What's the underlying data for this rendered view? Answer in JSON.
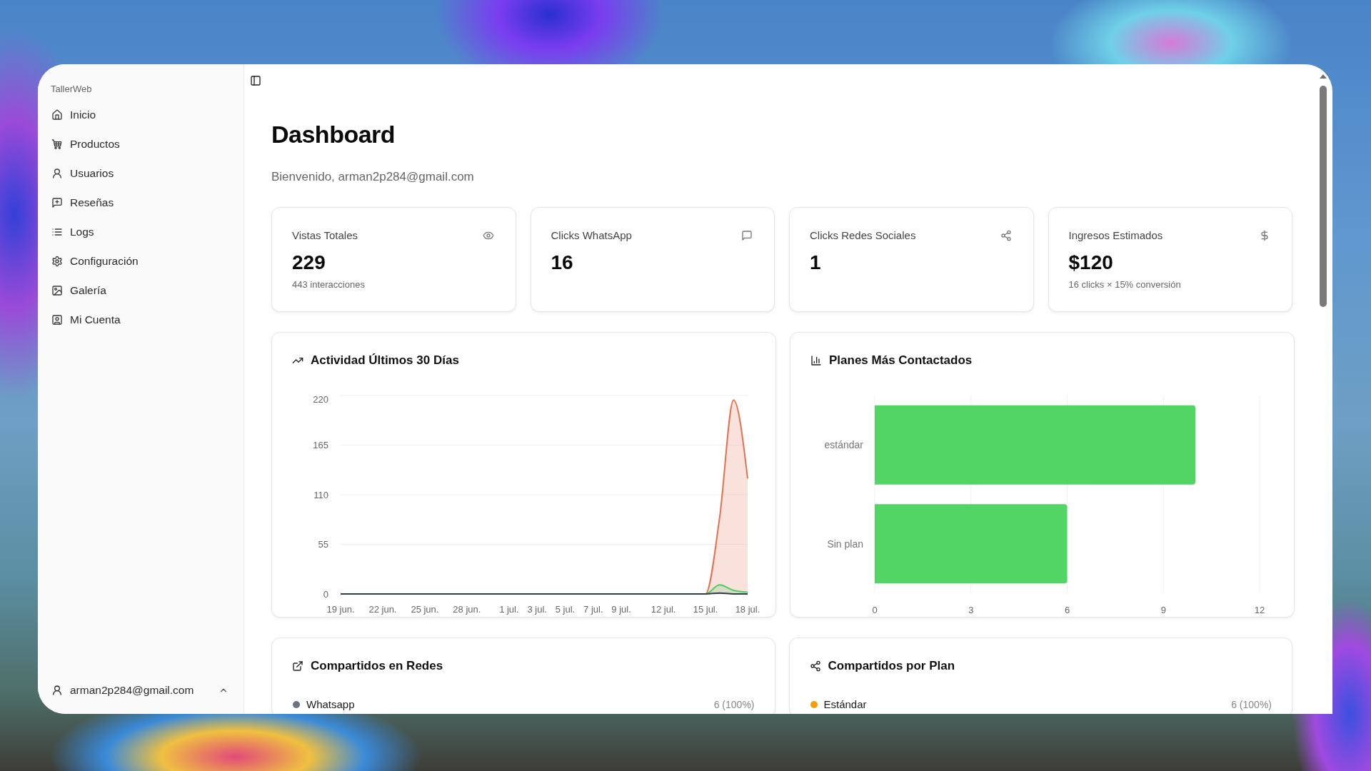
{
  "sidebar": {
    "brand": "TallerWeb",
    "items": [
      {
        "label": "Inicio"
      },
      {
        "label": "Productos"
      },
      {
        "label": "Usuarios"
      },
      {
        "label": "Reseñas"
      },
      {
        "label": "Logs"
      },
      {
        "label": "Configuración"
      },
      {
        "label": "Galería"
      },
      {
        "label": "Mi Cuenta"
      }
    ],
    "account": {
      "email": "arman2p284@gmail.com"
    }
  },
  "header": {
    "title": "Dashboard",
    "subtitle": "Bienvenido, arman2p284@gmail.com"
  },
  "stats": [
    {
      "label": "Vistas Totales",
      "value": "229",
      "detail": "443 interacciones"
    },
    {
      "label": "Clicks WhatsApp",
      "value": "16"
    },
    {
      "label": "Clicks Redes Sociales",
      "value": "1"
    },
    {
      "label": "Ingresos Estimados",
      "value": "$120",
      "detail": "16 clicks × 15% conversión"
    }
  ],
  "activity_chart": {
    "title": "Actividad Últimos 30 Días",
    "chart_data": {
      "type": "area",
      "stacked": false,
      "grid": true,
      "categories": [
        "19 jun.",
        null,
        null,
        "22 jun.",
        null,
        null,
        "25 jun.",
        null,
        null,
        "28 jun.",
        null,
        null,
        "1 jul.",
        null,
        "3 jul.",
        null,
        "5 jul.",
        null,
        "7 jul.",
        null,
        "9 jul.",
        null,
        null,
        "12 jul.",
        null,
        null,
        "15 jul.",
        null,
        null,
        "18 jul."
      ],
      "ylim": [
        0,
        220
      ],
      "yticks": [
        0,
        55,
        110,
        165,
        220
      ],
      "series": [
        {
          "color": "#e5704f",
          "values": [
            0,
            0,
            0,
            0,
            0,
            0,
            0,
            0,
            0,
            0,
            0,
            0,
            0,
            0,
            0,
            0,
            0,
            0,
            0,
            0,
            0,
            0,
            0,
            0,
            0,
            0,
            0,
            84,
            215,
            128
          ]
        },
        {
          "color": "#4ccf63",
          "values": [
            0,
            0,
            0,
            0,
            0,
            0,
            0,
            0,
            0,
            0,
            0,
            0,
            0,
            0,
            0,
            0,
            0,
            0,
            0,
            0,
            0,
            0,
            0,
            0,
            0,
            0,
            0,
            10,
            4,
            2
          ]
        },
        {
          "color": "#2f3e4e",
          "values": [
            0,
            0,
            0,
            0,
            0,
            0,
            0,
            0,
            0,
            0,
            0,
            0,
            0,
            0,
            0,
            0,
            0,
            0,
            0,
            0,
            0,
            0,
            0,
            0,
            0,
            0,
            0,
            1,
            0,
            0
          ]
        }
      ]
    }
  },
  "plans_chart": {
    "title": "Planes Más Contactados",
    "chart_data": {
      "type": "bar",
      "orientation": "horizontal",
      "grid": true,
      "categories": [
        "estándar",
        "Sin plan"
      ],
      "series": [
        {
          "color": "#53d566",
          "values": [
            10,
            6
          ]
        }
      ],
      "xlim": [
        0,
        12
      ],
      "xticks": [
        0,
        3,
        6,
        9,
        12
      ]
    }
  },
  "shares_by_network": {
    "title": "Compartidos en Redes",
    "items": [
      {
        "label": "Whatsapp",
        "value": "6 (100%)",
        "color": "#6b7280"
      }
    ]
  },
  "shares_by_plan": {
    "title": "Compartidos por Plan",
    "items": [
      {
        "label": "Estándar",
        "value": "6 (100%)",
        "color": "#f59e0b"
      }
    ]
  }
}
